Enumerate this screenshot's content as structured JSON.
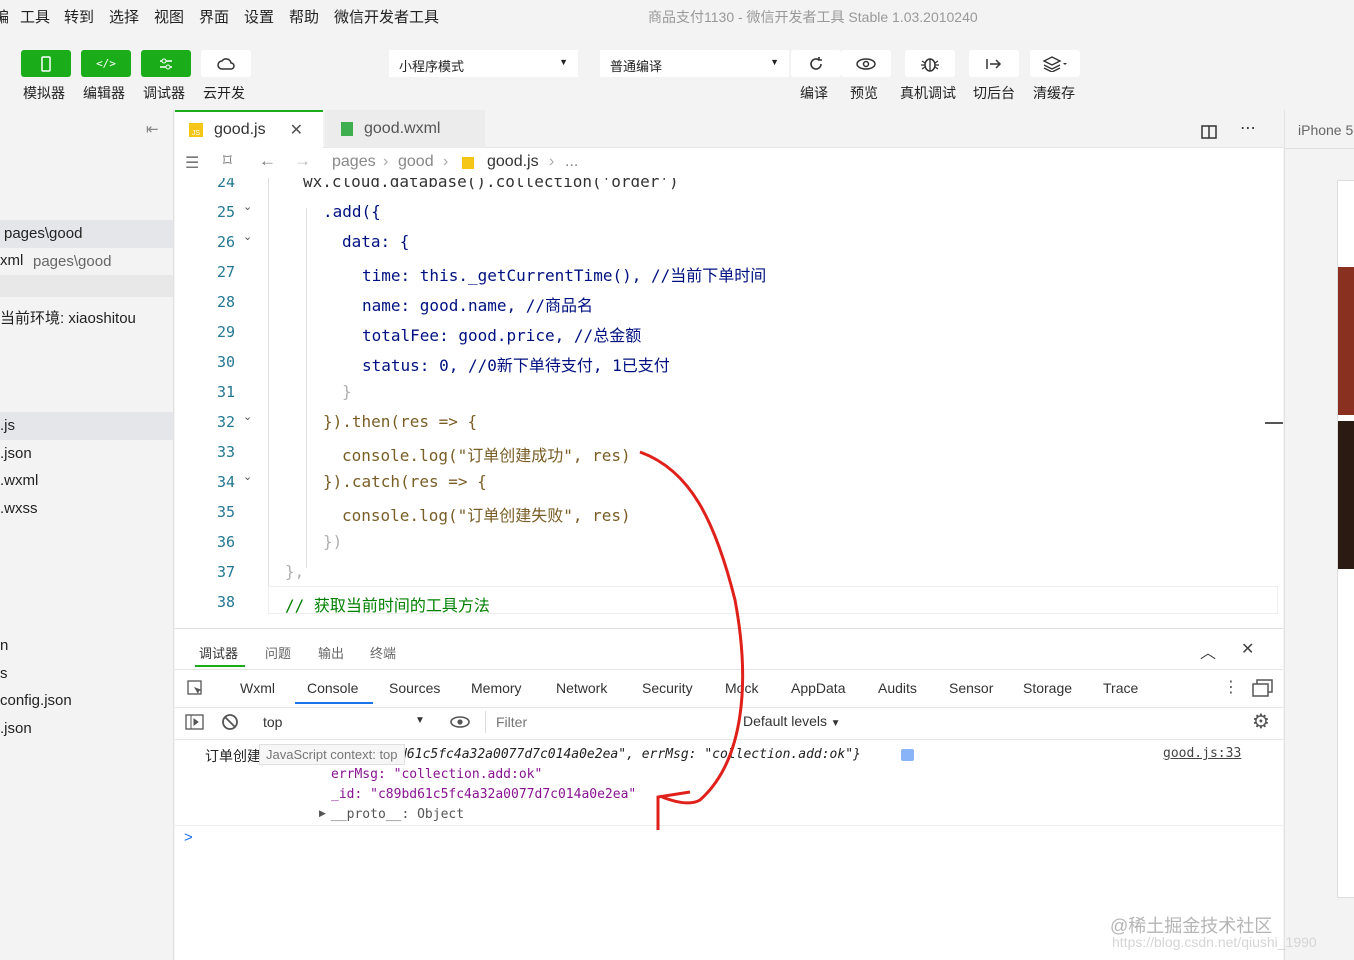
{
  "menu": [
    "编",
    "工具",
    "转到",
    "选择",
    "视图",
    "界面",
    "设置",
    "帮助",
    "微信开发者工具"
  ],
  "window_title": "商品支付1130 - 微信开发者工具 Stable 1.03.2010240",
  "toolbar": {
    "left": [
      {
        "label": "模拟器",
        "icon": "phone-icon"
      },
      {
        "label": "编辑器",
        "icon": "code-icon"
      },
      {
        "label": "调试器",
        "icon": "debug-icon"
      },
      {
        "label": "云开发",
        "icon": "cloud-icon"
      }
    ],
    "mode_select": "小程序模式",
    "compile_select": "普通编译",
    "right": [
      {
        "label": "编译",
        "icon": "refresh-icon"
      },
      {
        "label": "预览",
        "icon": "eye-icon"
      },
      {
        "label": "真机调试",
        "icon": "bug-icon"
      },
      {
        "label": "切后台",
        "icon": "switch-icon"
      },
      {
        "label": "清缓存",
        "icon": "layers-icon"
      }
    ]
  },
  "explorer": {
    "items": [
      "pages\\good",
      "xml",
      "pages\\good",
      "当前环境: xiaoshitou",
      ".js",
      ".json",
      ".wxml",
      ".wxss",
      "n",
      "s",
      "config.json",
      ".json"
    ]
  },
  "tabs": [
    {
      "label": "good.js",
      "active": true
    },
    {
      "label": "good.wxml",
      "active": false
    }
  ],
  "breadcrumb": [
    "pages",
    "good",
    "good.js",
    "..."
  ],
  "editor": {
    "line_numbers": [
      "24",
      "25",
      "26",
      "27",
      "28",
      "29",
      "30",
      "31",
      "32",
      "33",
      "34",
      "35",
      "36",
      "37",
      "38"
    ],
    "lines": [
      "wx.cloud.database().collection('order')",
      ".add({",
      "data: {",
      "time: this._getCurrentTime(), //当前下单时间",
      "name: good.name, //商品名",
      "totalFee: good.price, //总金额",
      "status: 0, //0新下单待支付, 1已支付",
      "}",
      "}).then(res => {",
      "console.log(\"订单创建成功\", res)",
      "}).catch(res => {",
      "console.log(\"订单创建失败\", res)",
      "})",
      "},",
      "// 获取当前时间的工具方法"
    ]
  },
  "devtools": {
    "top_tabs": [
      "调试器",
      "问题",
      "输出",
      "终端"
    ],
    "tabs": [
      "Wxml",
      "Console",
      "Sources",
      "Memory",
      "Network",
      "Security",
      "Mock",
      "AppData",
      "Audits",
      "Sensor",
      "Storage",
      "Trace"
    ],
    "active_tab": "Console",
    "context": "top",
    "filter_placeholder": "Filter",
    "levels": "Default levels",
    "console": {
      "message": "订单创建成功",
      "tooltip": "JavaScript context: top",
      "object_summary": "{_id: \"c89bd61c5fc4a32a0077d7c014a0e2ea\", errMsg: \"collection.add:ok\"}",
      "source": "good.js:33",
      "errMsg_line": "errMsg: \"collection.add:ok\"",
      "id_line": "_id: \"c89bd61c5fc4a32a0077d7c014a0e2ea\"",
      "proto_line": "__proto__: Object",
      "prompt": ">"
    }
  },
  "simulator_label": "iPhone 5",
  "watermark": "@稀土掘金技术社区",
  "watermark2": "https://blog.csdn.net/qiushi_1990",
  "colors": {
    "green": "#1aad19",
    "annotation": "#e0201a"
  }
}
